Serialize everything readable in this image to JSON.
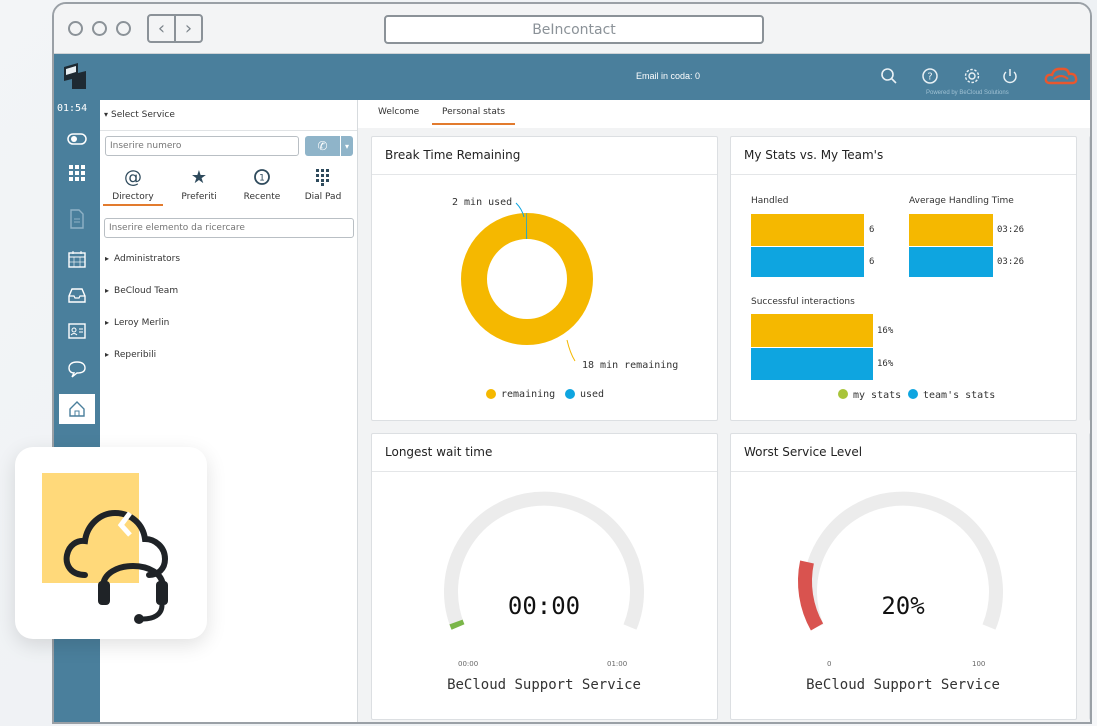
{
  "browser": {
    "address_bar": "BeIncontact"
  },
  "topbar": {
    "email_queue": "Email in coda: 0",
    "powered_by": "Powered by BeCloud Solutions"
  },
  "rail": {
    "timer": "01:54"
  },
  "service_panel": {
    "select_service": "Select Service",
    "number_placeholder": "Inserire numero",
    "tabs": [
      {
        "label": "Directory",
        "icon": "at-icon"
      },
      {
        "label": "Preferiti",
        "icon": "star-icon"
      },
      {
        "label": "Recente",
        "icon": "history-icon"
      },
      {
        "label": "Dial Pad",
        "icon": "dialpad-icon"
      }
    ],
    "search_placeholder": "Inserire elemento da ricercare",
    "groups": [
      "Administrators",
      "BeCloud Team",
      "Leroy Merlin",
      "Reperibili"
    ]
  },
  "content_tabs": [
    "Welcome",
    "Personal stats"
  ],
  "cards": {
    "break_time": {
      "title": "Break Time Remaining",
      "used_label": "2 min used",
      "remaining_label": "18 min remaining",
      "legend": [
        "remaining",
        "used"
      ]
    },
    "my_stats": {
      "title": "My Stats vs. My Team's",
      "handled_label": "Handled",
      "handled_values": [
        "6",
        "6"
      ],
      "aht_label": "Average Handling Time",
      "aht_values": [
        "03:26",
        "03:26"
      ],
      "success_label": "Successful interactions",
      "success_values": [
        "16%",
        "16%"
      ],
      "legend": [
        "my stats",
        "team's stats"
      ]
    },
    "longest_wait": {
      "title": "Longest wait time",
      "value": "00:00",
      "min": "00:00",
      "max": "01:00",
      "service": "BeCloud Support Service"
    },
    "worst_service": {
      "title": "Worst Service Level",
      "value": "20%",
      "min": "0",
      "max": "100",
      "service": "BeCloud Support Service"
    }
  },
  "colors": {
    "topbar": "#4a7f9c",
    "accent_orange": "#e27b2e",
    "yellow": "#f5b800",
    "blue": "#0ea5e0",
    "green": "#a8c43a",
    "red": "#d9534f"
  },
  "chart_data": [
    {
      "type": "pie",
      "title": "Break Time Remaining",
      "categories": [
        "remaining",
        "used"
      ],
      "values": [
        18,
        2
      ],
      "unit": "min"
    },
    {
      "type": "bar",
      "title": "My Stats vs. My Team's",
      "categories": [
        "Handled",
        "Average Handling Time",
        "Successful interactions"
      ],
      "series": [
        {
          "name": "my stats",
          "values": [
            "6",
            "03:26",
            "16%"
          ]
        },
        {
          "name": "team's stats",
          "values": [
            "6",
            "03:26",
            "16%"
          ]
        }
      ]
    },
    {
      "type": "gauge",
      "title": "Longest wait time",
      "value": 0,
      "range": [
        "00:00",
        "01:00"
      ]
    },
    {
      "type": "gauge",
      "title": "Worst Service Level",
      "value": 20,
      "range": [
        0,
        100
      ]
    }
  ]
}
